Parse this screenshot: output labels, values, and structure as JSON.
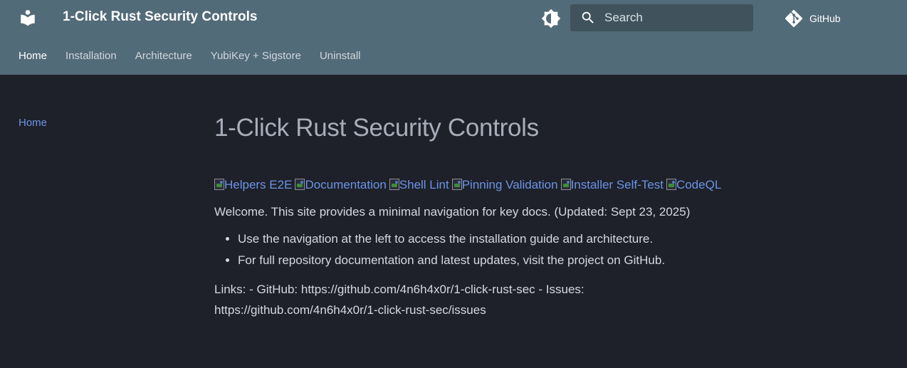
{
  "header": {
    "site_title": "1-Click Rust Security Controls",
    "search_placeholder": "Search",
    "repo_label": "GitHub"
  },
  "tabs": [
    {
      "label": "Home",
      "active": true
    },
    {
      "label": "Installation"
    },
    {
      "label": "Architecture"
    },
    {
      "label": "YubiKey + Sigstore"
    },
    {
      "label": "Uninstall"
    }
  ],
  "sidebar": {
    "items": [
      {
        "label": "Home"
      }
    ]
  },
  "content": {
    "title": "1-Click Rust Security Controls",
    "badges": [
      "Helpers E2E",
      "Documentation",
      "Shell Lint",
      "Pinning Validation",
      "Installer Self-Test",
      "CodeQL"
    ],
    "welcome": "Welcome. This site provides a minimal navigation for key docs. (Updated: Sept 23, 2025)",
    "bullets": [
      "Use the navigation at the left to access the installation guide and architecture.",
      "For full repository documentation and latest updates, visit the project on GitHub."
    ],
    "links_text": "Links: - GitHub: https://github.com/4n6h4x0r/1-click-rust-sec - Issues: https://github.com/4n6h4x0r/1-click-rust-sec/issues"
  },
  "colors": {
    "header_bg": "#526b78",
    "page_bg": "#1e2129",
    "link": "#6c93e6"
  }
}
